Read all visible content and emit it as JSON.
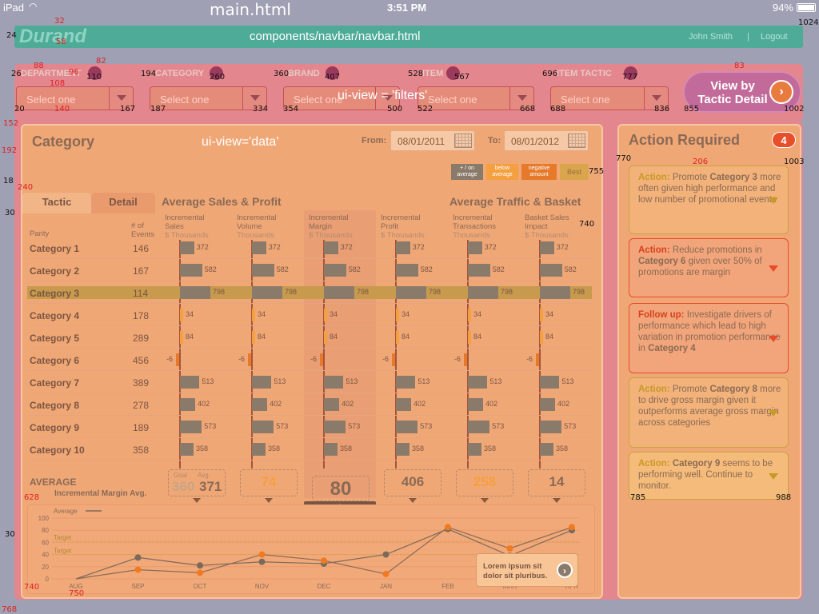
{
  "statusbar": {
    "device": "iPad",
    "time": "3:51 PM",
    "battery": "94%"
  },
  "page_label": "main.html",
  "navbar": {
    "logo": "Durand",
    "label": "components/navbar/navbar.html",
    "user": "John Smith",
    "separator": "|",
    "logout": "Logout"
  },
  "filters": {
    "view_label": "ui-view = 'filters'",
    "items": [
      {
        "label": "DEPARTMENT",
        "value": "Select one"
      },
      {
        "label": "CATEGORY",
        "value": "Select one"
      },
      {
        "label": "BRAND",
        "value": "Select one"
      },
      {
        "label": "ITEM",
        "value": "Select one"
      },
      {
        "label": "ITEM TACTIC",
        "value": "Select one"
      }
    ],
    "view_button": "View by Tactic Detail"
  },
  "data": {
    "title": "Category",
    "view_label": "ui-view='data'",
    "from_label": "From:",
    "from": "08/01/2011",
    "to_label": "To:",
    "to": "08/01/2012",
    "legend": [
      {
        "label": "+ / on average",
        "color": "#8a7a6a"
      },
      {
        "label": "below average",
        "color": "#f5a040"
      },
      {
        "label": "negative amount",
        "color": "#e67a2a"
      },
      {
        "label": "Best",
        "color": "#d9a64e"
      }
    ],
    "tabs": [
      "Tactic",
      "Detail"
    ],
    "section1": "Average Sales & Profit",
    "section2": "Average Traffic & Basket",
    "parity": "Parity",
    "events": "# of Events",
    "columns": [
      {
        "h1": "Incremental",
        "h2": "Sales",
        "u": "$ Thousands"
      },
      {
        "h1": "Incremental",
        "h2": "Volume",
        "u": "Thousands"
      },
      {
        "h1": "Incremental",
        "h2": "Margin",
        "u": "$ Thousands"
      },
      {
        "h1": "Incremental",
        "h2": "Profit",
        "u": "$ Thousands"
      },
      {
        "h1": "Incremental",
        "h2": "Transactions",
        "u": "Thousands"
      },
      {
        "h1": "Basket Sales",
        "h2": "Impact",
        "u": "$ Thousands"
      }
    ],
    "rows": [
      {
        "label": "Category 1",
        "events": "146",
        "value": "372"
      },
      {
        "label": "Category 2",
        "events": "167",
        "value": "582"
      },
      {
        "label": "Category 3",
        "events": "114",
        "value": "798"
      },
      {
        "label": "Category 4",
        "events": "178",
        "value": "34"
      },
      {
        "label": "Category 5",
        "events": "289",
        "value": "84"
      },
      {
        "label": "Category 6",
        "events": "456",
        "value": "-6"
      },
      {
        "label": "Category 7",
        "events": "389",
        "value": "513"
      },
      {
        "label": "Category 8",
        "events": "278",
        "value": "402"
      },
      {
        "label": "Category 9",
        "events": "189",
        "value": "573"
      },
      {
        "label": "Category 10",
        "events": "358",
        "value": "358"
      }
    ],
    "average_label": "AVERAGE",
    "goal_label": "Goal",
    "avg_label": "Avg.",
    "goal": "360",
    "avg": "371",
    "averages": [
      "74",
      "80",
      "406",
      "258",
      "14"
    ],
    "margin_avg_label": "Incremental Margin Avg."
  },
  "chart_data": {
    "type": "line",
    "x": [
      "AUG",
      "SEP",
      "OCT",
      "NOV",
      "DEC",
      "JAN",
      "FEB",
      "MAR",
      "APR"
    ],
    "yticks": [
      0,
      20,
      40,
      60,
      80,
      100
    ],
    "ylim": [
      0,
      100
    ],
    "legend": "Average",
    "target_label": "Target",
    "callout": "Lorem ipsum sit dolor sit pluribus.",
    "series": [
      {
        "values": [
          0,
          35,
          22,
          28,
          25,
          40,
          82,
          38,
          80
        ]
      },
      {
        "values": [
          0,
          15,
          10,
          40,
          30,
          8,
          85,
          50,
          85
        ]
      }
    ]
  },
  "actions": {
    "title": "Action Required",
    "count": "4",
    "items": [
      {
        "kind": "Action:",
        "text": "Promote ",
        "bold": "Category 3",
        "rest": " more often given high performance and low number of promotional events",
        "border": "#c8a43a",
        "bg": "#f2b27a",
        "tri": "#c79a26"
      },
      {
        "kind": "Action:",
        "text": "Reduce promotions in ",
        "bold": "Category 6",
        "rest": " given over 50% of promotions are margin",
        "border": "#e84a2a",
        "bg": "#f2a57a",
        "tri": "#e84a2a"
      },
      {
        "kind": "Follow up:",
        "text": "Investigate drivers of performance which lead to high variation in promotion performance in ",
        "bold": "Category 4",
        "rest": "",
        "border": "#e84a2a",
        "bg": "#f2a57a",
        "tri": "#e84a2a"
      },
      {
        "kind": "Action:",
        "text": "Promote ",
        "bold": "Category 8",
        "rest": " more to drive gross margin given it outperforms average gross margin across categories",
        "border": "#c8a43a",
        "bg": "#f2b27a",
        "tri": "#c79a26"
      },
      {
        "kind": "Action:",
        "text": " ",
        "bold": "Category 9",
        "rest": " seems to be performing well. Continue to monitor.",
        "border": "#c8a43a",
        "bg": "#f5bb7a",
        "tri": "#c79a26"
      }
    ]
  },
  "annotations": [
    {
      "t": "32",
      "c": "red",
      "l": 68,
      "tp": 22
    },
    {
      "t": "24",
      "c": "blk",
      "l": 8,
      "tp": 40
    },
    {
      "t": "58",
      "c": "red",
      "l": 70,
      "tp": 48
    },
    {
      "t": "1024",
      "c": "blk",
      "l": 998,
      "tp": 24
    },
    {
      "t": "88",
      "c": "red",
      "l": 42,
      "tp": 78
    },
    {
      "t": "82",
      "c": "red",
      "l": 120,
      "tp": 72
    },
    {
      "t": "83",
      "c": "red",
      "l": 918,
      "tp": 78
    },
    {
      "t": "26",
      "c": "blk",
      "l": 14,
      "tp": 88
    },
    {
      "t": "96",
      "c": "red",
      "l": 86,
      "tp": 86
    },
    {
      "t": "110",
      "c": "blk",
      "l": 108,
      "tp": 92
    },
    {
      "t": "194",
      "c": "blk",
      "l": 176,
      "tp": 88
    },
    {
      "t": "260",
      "c": "blk",
      "l": 262,
      "tp": 92
    },
    {
      "t": "360",
      "c": "blk",
      "l": 342,
      "tp": 88
    },
    {
      "t": "407",
      "c": "blk",
      "l": 406,
      "tp": 92
    },
    {
      "t": "528",
      "c": "blk",
      "l": 510,
      "tp": 88
    },
    {
      "t": "567",
      "c": "blk",
      "l": 568,
      "tp": 92
    },
    {
      "t": "696",
      "c": "blk",
      "l": 678,
      "tp": 88
    },
    {
      "t": "777",
      "c": "blk",
      "l": 778,
      "tp": 92
    },
    {
      "t": "108",
      "c": "red",
      "l": 62,
      "tp": 100
    },
    {
      "t": "20",
      "c": "blk",
      "l": 18,
      "tp": 132
    },
    {
      "t": "140",
      "c": "red",
      "l": 68,
      "tp": 132
    },
    {
      "t": "167",
      "c": "blk",
      "l": 150,
      "tp": 132
    },
    {
      "t": "187",
      "c": "blk",
      "l": 188,
      "tp": 132
    },
    {
      "t": "334",
      "c": "blk",
      "l": 316,
      "tp": 132
    },
    {
      "t": "354",
      "c": "blk",
      "l": 354,
      "tp": 132
    },
    {
      "t": "500",
      "c": "blk",
      "l": 484,
      "tp": 132
    },
    {
      "t": "522",
      "c": "blk",
      "l": 522,
      "tp": 132
    },
    {
      "t": "668",
      "c": "blk",
      "l": 650,
      "tp": 132
    },
    {
      "t": "688",
      "c": "blk",
      "l": 688,
      "tp": 132
    },
    {
      "t": "836",
      "c": "blk",
      "l": 818,
      "tp": 132
    },
    {
      "t": "855",
      "c": "blk",
      "l": 855,
      "tp": 132
    },
    {
      "t": "1002",
      "c": "blk",
      "l": 980,
      "tp": 132
    },
    {
      "t": "152",
      "c": "red",
      "l": 4,
      "tp": 150
    },
    {
      "t": "192",
      "c": "red",
      "l": 2,
      "tp": 184
    },
    {
      "t": "770",
      "c": "blk",
      "l": 770,
      "tp": 194
    },
    {
      "t": "206",
      "c": "red",
      "l": 866,
      "tp": 198
    },
    {
      "t": "1003",
      "c": "blk",
      "l": 980,
      "tp": 198
    },
    {
      "t": "755",
      "c": "blk",
      "l": 736,
      "tp": 210
    },
    {
      "t": "18",
      "c": "blk",
      "l": 4,
      "tp": 222
    },
    {
      "t": "240",
      "c": "red",
      "l": 22,
      "tp": 230
    },
    {
      "t": "30",
      "c": "blk",
      "l": 6,
      "tp": 262
    },
    {
      "t": "740",
      "c": "blk",
      "l": 724,
      "tp": 276
    },
    {
      "t": "785",
      "c": "blk",
      "l": 788,
      "tp": 618
    },
    {
      "t": "988",
      "c": "blk",
      "l": 970,
      "tp": 618
    },
    {
      "t": "628",
      "c": "red",
      "l": 30,
      "tp": 618
    },
    {
      "t": "30",
      "c": "blk",
      "l": 6,
      "tp": 664
    },
    {
      "t": "740",
      "c": "red",
      "l": 30,
      "tp": 730
    },
    {
      "t": "750",
      "c": "red",
      "l": 86,
      "tp": 738
    },
    {
      "t": "768",
      "c": "red",
      "l": 2,
      "tp": 758
    }
  ]
}
